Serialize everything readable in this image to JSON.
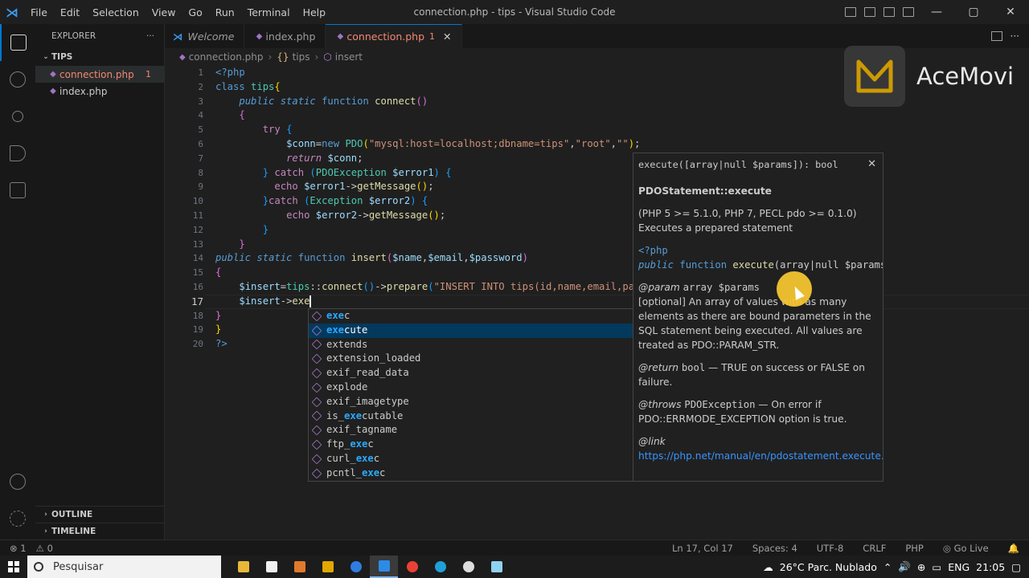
{
  "window": {
    "title": "connection.php - tips - Visual Studio Code",
    "menu": [
      "File",
      "Edit",
      "Selection",
      "View",
      "Go",
      "Run",
      "Terminal",
      "Help"
    ],
    "controls": {
      "minimize": "—",
      "maximize": "▢",
      "close": "✕"
    }
  },
  "sidebar": {
    "header": "EXPLORER",
    "more": "···",
    "folder": "TIPS",
    "files": [
      {
        "name": "connection.php",
        "badge": "1"
      },
      {
        "name": "index.php"
      }
    ],
    "outline": "OUTLINE",
    "timeline": "TIMELINE"
  },
  "tabs": [
    {
      "label": "Welcome"
    },
    {
      "label": "index.php"
    },
    {
      "label": "connection.php",
      "badge": "1",
      "close": "✕"
    }
  ],
  "breadcrumb": {
    "file": "connection.php",
    "class": "tips",
    "method": "insert",
    "sep": "›"
  },
  "editor": {
    "line_numbers": [
      "1",
      "2",
      "3",
      "4",
      "5",
      "6",
      "7",
      "8",
      "9",
      "10",
      "11",
      "12",
      "13",
      "14",
      "15",
      "16",
      "17",
      "18",
      "19",
      "20"
    ],
    "current_line": "17"
  },
  "suggest": {
    "typed": "exe",
    "items": [
      "exec",
      "execute",
      "extends",
      "extension_loaded",
      "exif_read_data",
      "explode",
      "exif_imagetype",
      "is_executable",
      "exif_tagname",
      "ftp_exec",
      "curl_exec",
      "pcntl_exec"
    ],
    "selected_index": 1
  },
  "details": {
    "signature": "execute([array|null $params]): bool",
    "close": "✕",
    "title": "PDOStatement::execute",
    "version": "(PHP 5 >= 5.1.0, PHP 7, PECL pdo >= 0.1.0)",
    "summary": "Executes a prepared statement",
    "code_open": "<?php",
    "code_public": "public",
    "code_function": "function",
    "code_name": "execute",
    "code_args": "(array|null $params",
    "param_tag": "@param",
    "param_sig": "array $params",
    "param_desc": "[optional] An array of values with as many elements as there are bound parameters in the SQL statement being executed. All values are treated as PDO::PARAM_STR.",
    "return_tag": "@return",
    "return_type": "bool",
    "return_desc": "— TRUE on success or FALSE on failure.",
    "throws_tag": "@throws",
    "throws_type": "PDOException",
    "throws_desc": "— On error if PDO::ERRMODE_EXCEPTION option is true.",
    "link_tag": "@link",
    "link_url": "https://php.net/manual/en/pdostatement.execute.php"
  },
  "watermark": {
    "text": "AceMovi"
  },
  "statusbar": {
    "errors": "⊗ 1",
    "warnings": "⚠ 0",
    "position": "Ln 17, Col 17",
    "spaces": "Spaces: 4",
    "encoding": "UTF-8",
    "eol": "CRLF",
    "language": "PHP",
    "golive": "Go Live"
  },
  "taskbar": {
    "search_placeholder": "Pesquisar",
    "weather": "26°C  Parc. Nublado",
    "lang": "ENG",
    "time": "21:05"
  },
  "colors": {
    "accent": "#0078d4",
    "error": "#f48771",
    "suggest_selected": "#04395e"
  }
}
